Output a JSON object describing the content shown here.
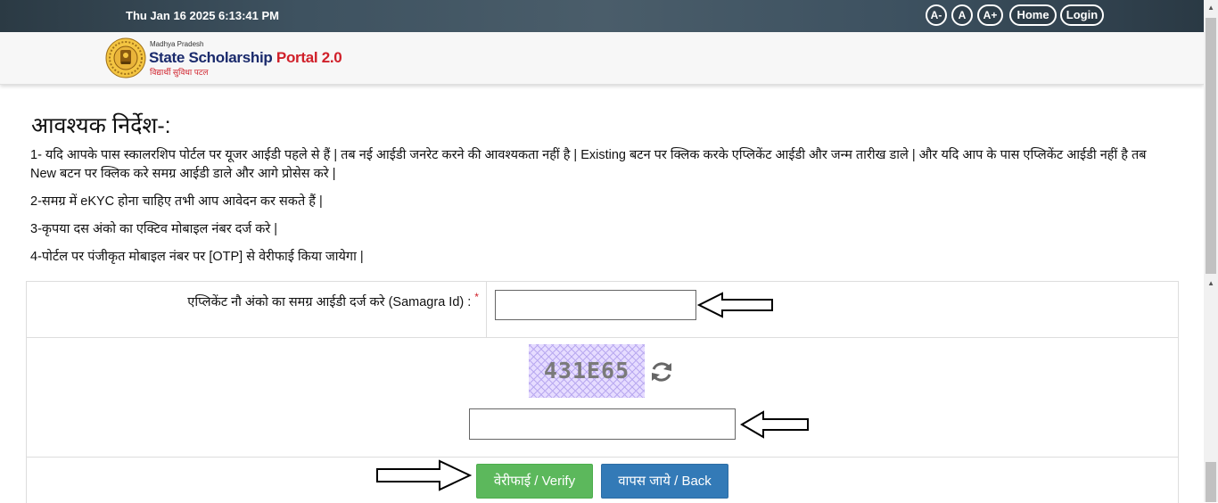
{
  "topbar": {
    "datetime": "Thu Jan 16 2025 6:13:41 PM",
    "font_decrease": "A-",
    "font_normal": "A",
    "font_increase": "A+",
    "home": "Home",
    "login": "Login"
  },
  "header": {
    "logo_state": "Madhya Pradesh",
    "logo_title_main": "State Scholarship ",
    "logo_title_accent": "Portal 2.0",
    "logo_subtitle": "विद्यार्थी सुविधा पटल"
  },
  "instructions": {
    "heading": "आवश्यक निर्देश-:",
    "items": [
      "1- यदि आपके पास स्कालरशिप पोर्टल पर यूजर आईडी पहले से हैं | तब नई आईडी जनरेट करने की आवश्यकता नहीं है | Existing बटन पर क्लिक करके एप्लिकेंट आईडी और जन्म तारीख डाले | और यदि आप के पास एप्लिकेंट आईडी नहीं है तब New बटन पर क्लिक करे समग्र आईडी डाले और आगे प्रोसेस करे |",
      "2-समग्र में eKYC होना चाहिए तभी आप आवेदन कर सकते हैं |",
      "3-कृपया दस अंको का एक्टिव मोबाइल नंबर दर्ज करे |",
      "4-पोर्टल पर पंजीकृत मोबाइल नंबर पर [OTP] से वेरीफाई किया जायेगा |"
    ]
  },
  "form": {
    "samagra_label": "एप्लिकेंट नौ अंको का समग्र आईडी दर्ज करे (Samagra Id) : ",
    "required_mark": "*",
    "samagra_value": "",
    "captcha_text": "431E65",
    "captcha_value": "",
    "verify_label": "वेरीफाई / Verify",
    "back_label": "वापस जाये / Back"
  },
  "colors": {
    "verify": "#5cb85c",
    "back": "#337ab7",
    "required": "#d0202a",
    "logo_title": "#1a2a6c"
  },
  "icons": {
    "refresh": "refresh-icon",
    "arrow": "arrow-pointer-icon"
  }
}
